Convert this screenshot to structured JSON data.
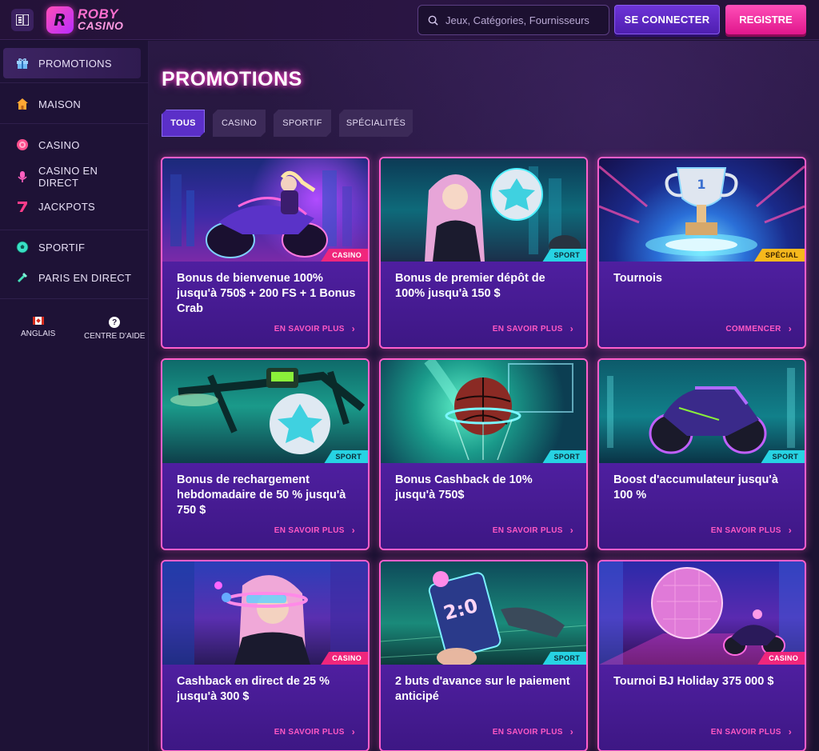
{
  "header": {
    "logo_line1": "ROBY",
    "logo_line2": "CASINO",
    "logo_mark": "R",
    "search_placeholder": "Jeux, Catégories, Fournisseurs",
    "login_label": "SE CONNECTER",
    "register_label": "REGISTRE"
  },
  "sidebar": {
    "items": [
      {
        "label": "PROMOTIONS",
        "icon": "gift-icon"
      },
      {
        "label": "MAISON",
        "icon": "home-icon"
      },
      {
        "label": "CASINO",
        "icon": "chip-icon"
      },
      {
        "label": "CASINO EN DIRECT",
        "icon": "microphone-icon"
      },
      {
        "label": "JACKPOTS",
        "icon": "seven-icon"
      },
      {
        "label": "SPORTIF",
        "icon": "soccer-ball-icon"
      },
      {
        "label": "PARIS EN DIRECT",
        "icon": "live-bet-icon"
      }
    ],
    "language_label": "ANGLAIS",
    "help_label": "CENTRE D'AIDE",
    "help_glyph": "?"
  },
  "main": {
    "title": "PROMOTIONS",
    "tabs": [
      "TOUS",
      "CASINO",
      "SPORTIF",
      "SPÉCIALITÉS"
    ],
    "cards": [
      {
        "title": "Bonus de bienvenue 100% jusqu'à 750$ + 200 FS + 1 Bonus Crab",
        "badge": "CASINO",
        "link": "EN SAVOIR PLUS"
      },
      {
        "title": "Bonus de premier dépôt de 100% jusqu'à 150 $",
        "badge": "SPORT",
        "link": "EN SAVOIR PLUS"
      },
      {
        "title": "Tournois",
        "badge": "SPÉCIAL",
        "link": "COMMENCER"
      },
      {
        "title": "Bonus de rechargement hebdomadaire de 50 % jusqu'à 750 $",
        "badge": "SPORT",
        "link": "EN SAVOIR PLUS"
      },
      {
        "title": "Bonus Cashback de 10% jusqu'à 750$",
        "badge": "SPORT",
        "link": "EN SAVOIR PLUS"
      },
      {
        "title": "Boost d'accumulateur jusqu'à 100 %",
        "badge": "SPORT",
        "link": "EN SAVOIR PLUS"
      },
      {
        "title": "Cashback en direct de 25 % jusqu'à 300 $",
        "badge": "CASINO",
        "link": "EN SAVOIR PLUS"
      },
      {
        "title": "2 buts d'avance sur le paiement anticipé",
        "badge": "SPORT",
        "link": "EN SAVOIR PLUS"
      },
      {
        "title": "Tournoi BJ Holiday 375 000 $",
        "badge": "CASINO",
        "link": "EN SAVOIR PLUS"
      }
    ]
  },
  "colors": {
    "accent_pink": "#ff5ecb",
    "accent_purple": "#5b2fc8",
    "badge_casino": "#f0267c",
    "badge_sport": "#27d3e3",
    "badge_special": "#f6b81c"
  }
}
